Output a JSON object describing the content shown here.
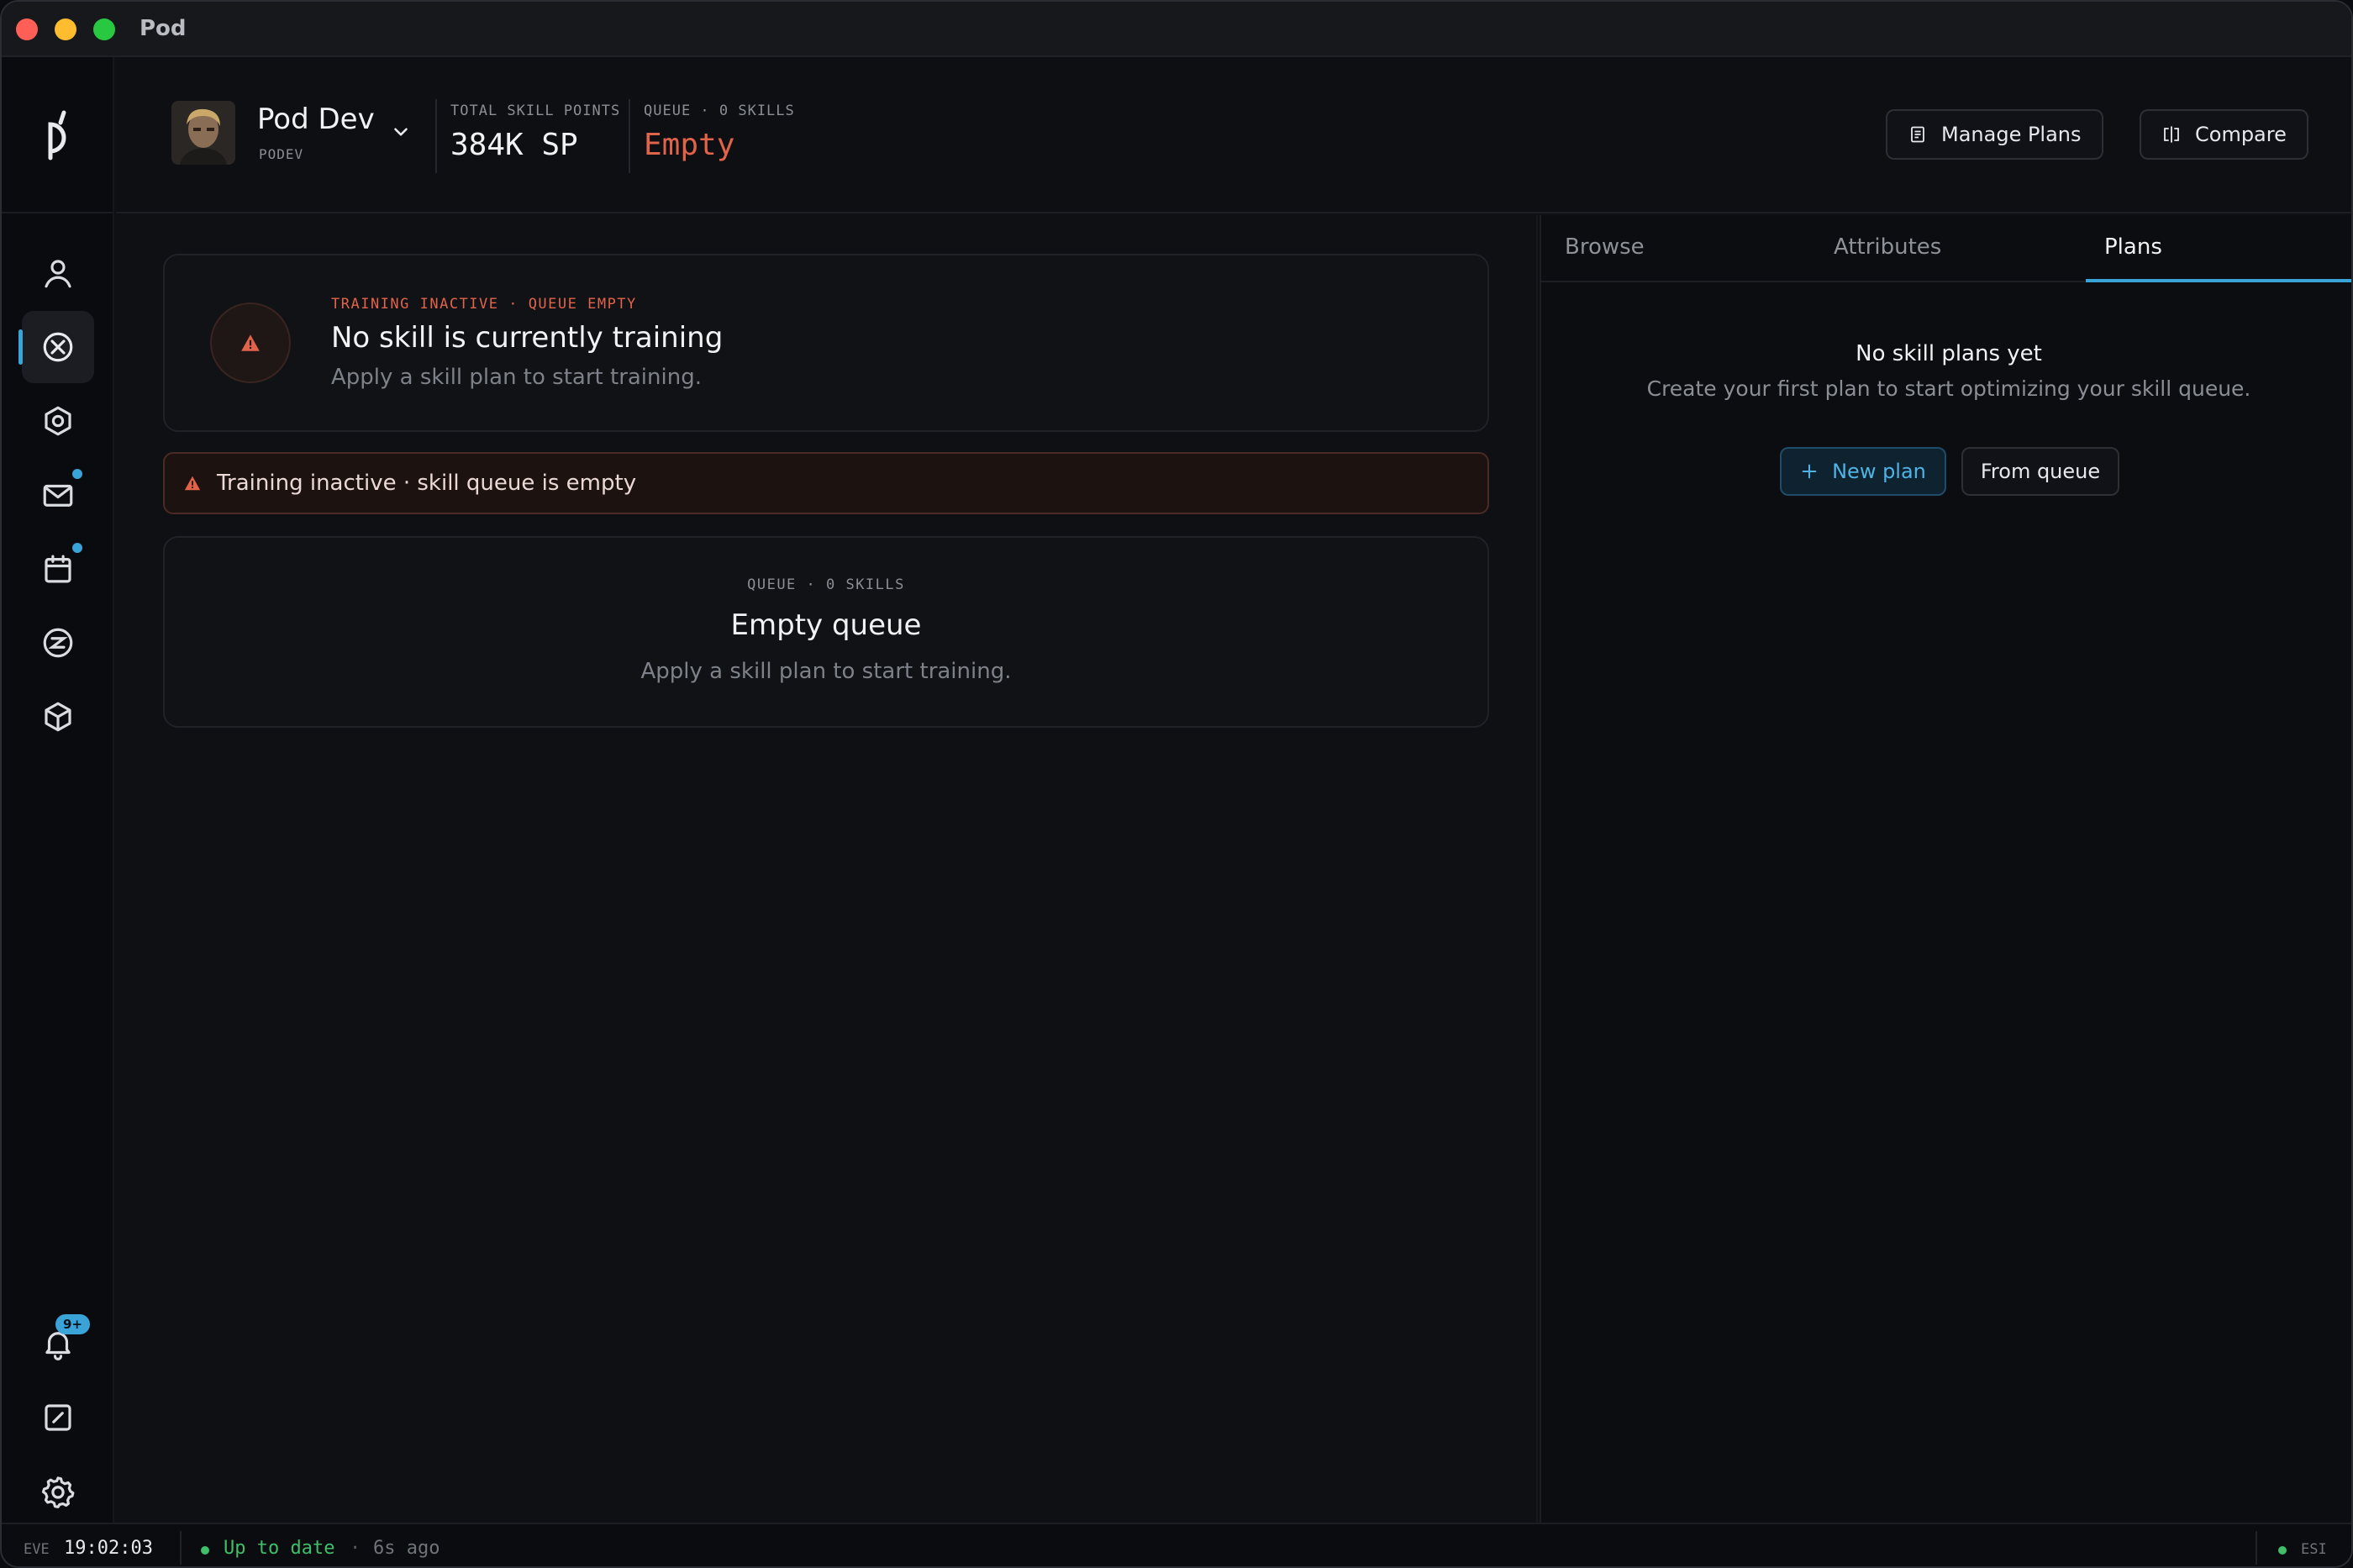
{
  "window": {
    "title": "Pod"
  },
  "nav": {
    "items": [
      {
        "icon": "person-icon"
      },
      {
        "icon": "skills-icon",
        "active": true
      },
      {
        "icon": "hexagon-icon"
      },
      {
        "icon": "mail-icon",
        "dot": true
      },
      {
        "icon": "calendar-icon",
        "dot": true
      },
      {
        "icon": "currency-icon"
      },
      {
        "icon": "cube-icon"
      }
    ],
    "bottom": {
      "notifications_badge": "9+"
    }
  },
  "header": {
    "character": {
      "name": "Pod Dev",
      "ticker": "PODEV"
    },
    "total_sp": {
      "label": "TOTAL SKILL POINTS",
      "value": "384K SP"
    },
    "queue": {
      "label": "QUEUE · 0 SKILLS",
      "value": "Empty"
    },
    "buttons": {
      "manage_plans": "Manage Plans",
      "compare": "Compare"
    }
  },
  "training_card": {
    "eyebrow": "TRAINING INACTIVE · QUEUE EMPTY",
    "title": "No skill is currently training",
    "subtitle": "Apply a skill plan to start training."
  },
  "alert": {
    "text": "Training inactive · skill queue is empty"
  },
  "queue_card": {
    "eyebrow": "QUEUE · 0 SKILLS",
    "title": "Empty queue",
    "subtitle": "Apply a skill plan to start training."
  },
  "right_panel": {
    "tabs": [
      {
        "label": "Browse"
      },
      {
        "label": "Attributes"
      },
      {
        "label": "Plans",
        "active": true
      }
    ],
    "empty_title": "No skill plans yet",
    "empty_subtitle": "Create your first plan to start optimizing your skill queue.",
    "new_plan_label": "New plan",
    "from_queue_label": "From queue"
  },
  "status_bar": {
    "clock_label": "EVE",
    "clock": "19:02:03",
    "sync_status": "Up to date",
    "sync_sep": "·",
    "sync_age": "6s ago",
    "esi_label": "ESI"
  },
  "colors": {
    "accent": "#3aa3d8",
    "warning": "#e0634a",
    "ok": "#3fbf6a"
  }
}
